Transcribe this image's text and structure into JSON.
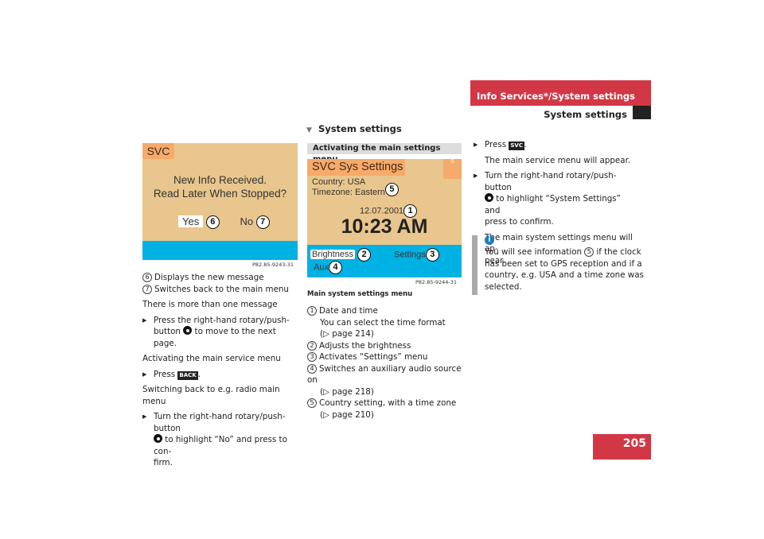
{
  "header": {
    "section": "Info Services*/System settings",
    "subsection": "System settings"
  },
  "page_number": "205",
  "left": {
    "screen": {
      "title": "SVC",
      "line1": "New Info Received.",
      "line2": "Read Later When Stopped?",
      "yes": "Yes",
      "no": "No",
      "callout_yes": "6",
      "callout_no": "7",
      "caption": "P82.85-9243-31"
    },
    "legend": [
      {
        "n": "6",
        "text": "Displays the new message"
      },
      {
        "n": "7",
        "text": "Switches back to the main menu"
      }
    ],
    "p1": "There is more than one message",
    "step1_a": "Press the right-hand rotary/push-",
    "step1_b": "button",
    "step1_c": "to move to the next page.",
    "p2": "Activating the main service menu",
    "step2": "Press",
    "back_key": "BACK",
    "p3": "Switching back to e.g. radio main menu",
    "step3_a": "Turn the right-hand rotary/push-button",
    "step3_b": "to highlight “No” and press to con-",
    "step3_c": "firm."
  },
  "middle": {
    "heading": "System settings",
    "subheading": "Activating the main settings menu",
    "screen": {
      "title": "SVC Sys Settings",
      "signal": "S",
      "country": "Country: USA",
      "timezone": "Timezone: Eastern",
      "date": "12.07.2001",
      "time": "10:23 AM",
      "brightness": "Brightness",
      "settings": "Settings",
      "aux": "Aux",
      "c1": "1",
      "c2": "2",
      "c3": "3",
      "c4": "4",
      "c5": "5",
      "caption": "P82.85-9244-31"
    },
    "figure_title": "Main system settings menu",
    "legend": [
      {
        "n": "1",
        "lines": [
          "Date and time",
          "You can select the time format",
          "(▷ page 214)"
        ]
      },
      {
        "n": "2",
        "lines": [
          "Adjusts the brightness"
        ]
      },
      {
        "n": "3",
        "lines": [
          "Activates “Settings” menu"
        ]
      },
      {
        "n": "4",
        "lines": [
          "Switches an auxiliary audio source on",
          "(▷ page 218)"
        ]
      },
      {
        "n": "5",
        "lines": [
          "Country setting, with a time zone",
          "(▷ page 210)"
        ]
      }
    ]
  },
  "right": {
    "step1": "Press",
    "svc_key": "SVC",
    "step1_result": "The main service menu will appear.",
    "step2_a": "Turn the right-hand rotary/push-button",
    "step2_b": "to highlight “System Settings” and",
    "step2_c": "press to confirm.",
    "step2_result_a": "The main system settings menu will ap-",
    "step2_result_b": "pear.",
    "info_icon": "i",
    "info_a": "You will see information",
    "info_n": "5",
    "info_b": "if the clock",
    "info_c": "has been set to GPS reception and if a",
    "info_d": "country, e.g. USA and a time zone was",
    "info_e": "selected."
  },
  "colors": {
    "accent": "#d23746",
    "screen_tan": "#e9c68d",
    "screen_blue": "#00b1e3",
    "screen_orange": "#f6aa6b"
  }
}
